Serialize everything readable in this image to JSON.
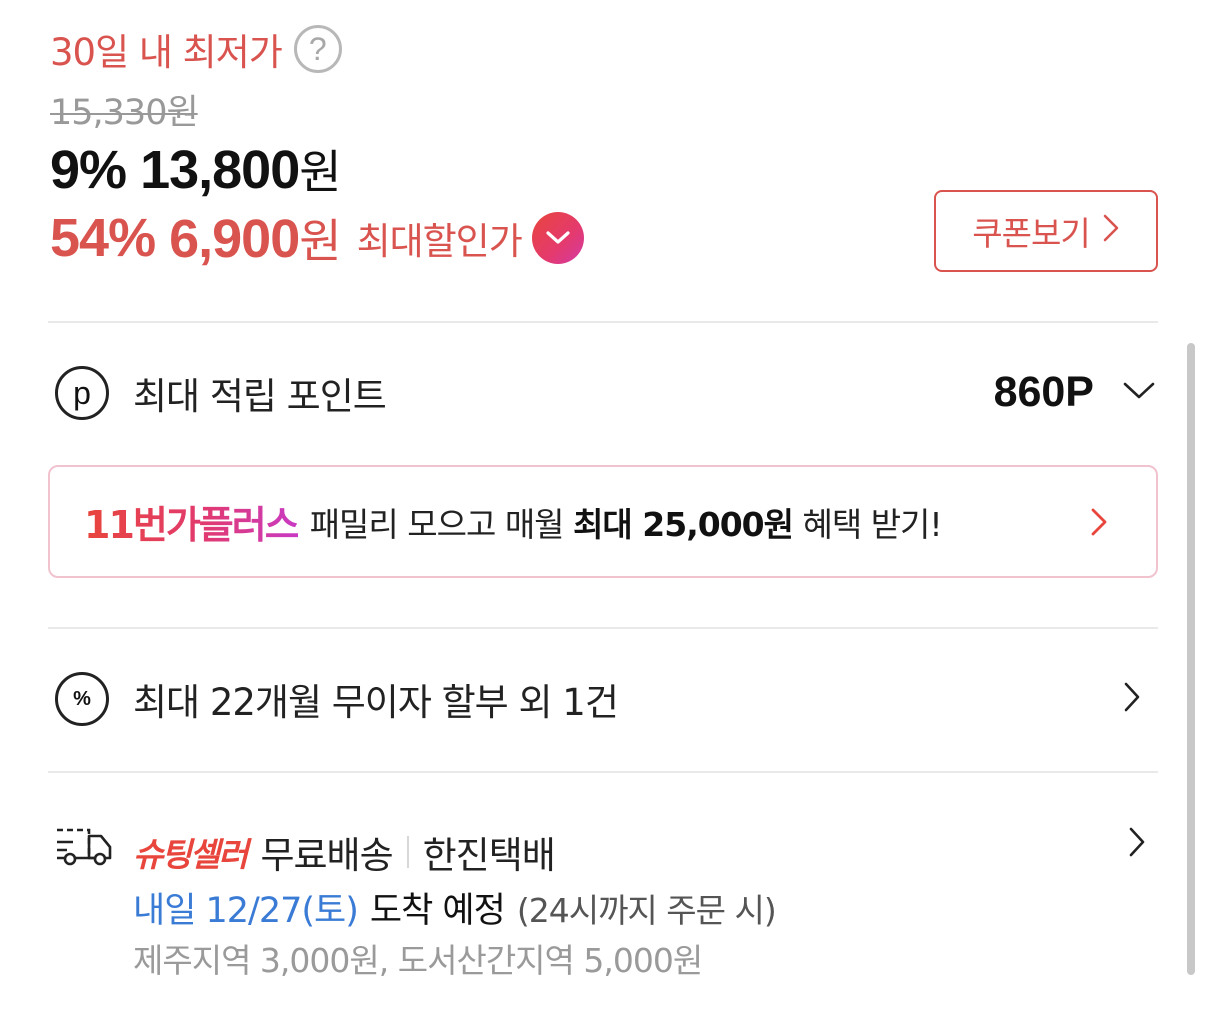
{
  "price": {
    "lowest_label": "30일 내 최저가",
    "help_glyph": "?",
    "original_price": "15,330원",
    "discount_rate": "9%",
    "sale_price": "13,800",
    "won": "원",
    "max_discount_rate": "54%",
    "max_discount_price": "6,900",
    "max_discount_label": "최대할인가",
    "coupon_button_label": "쿠폰보기"
  },
  "points": {
    "icon_glyph": "p",
    "label": "최대 적립 포인트",
    "value": "860P"
  },
  "plus_banner": {
    "logo": "11번가플러스",
    "text_before": "패밀리 모으고 매월",
    "text_bold": "최대 25,000원",
    "text_after": "혜택 받기!"
  },
  "installment": {
    "icon_glyph": "%",
    "label": "최대 22개월 무이자 할부 외 1건"
  },
  "delivery": {
    "badge": "슈팅셀러",
    "shipping": "무료배송",
    "carrier": "한진택배",
    "arrival_date": "내일 12/27(토)",
    "arrival_text": "도착 예정",
    "arrival_note": "(24시까지 주문 시)",
    "extra_fee": "제주지역 3,000원, 도서산간지역 5,000원"
  },
  "colors": {
    "accent_red": "#d9534f",
    "link_blue": "#3a7bd5",
    "muted_gray": "#9a9a9a"
  }
}
